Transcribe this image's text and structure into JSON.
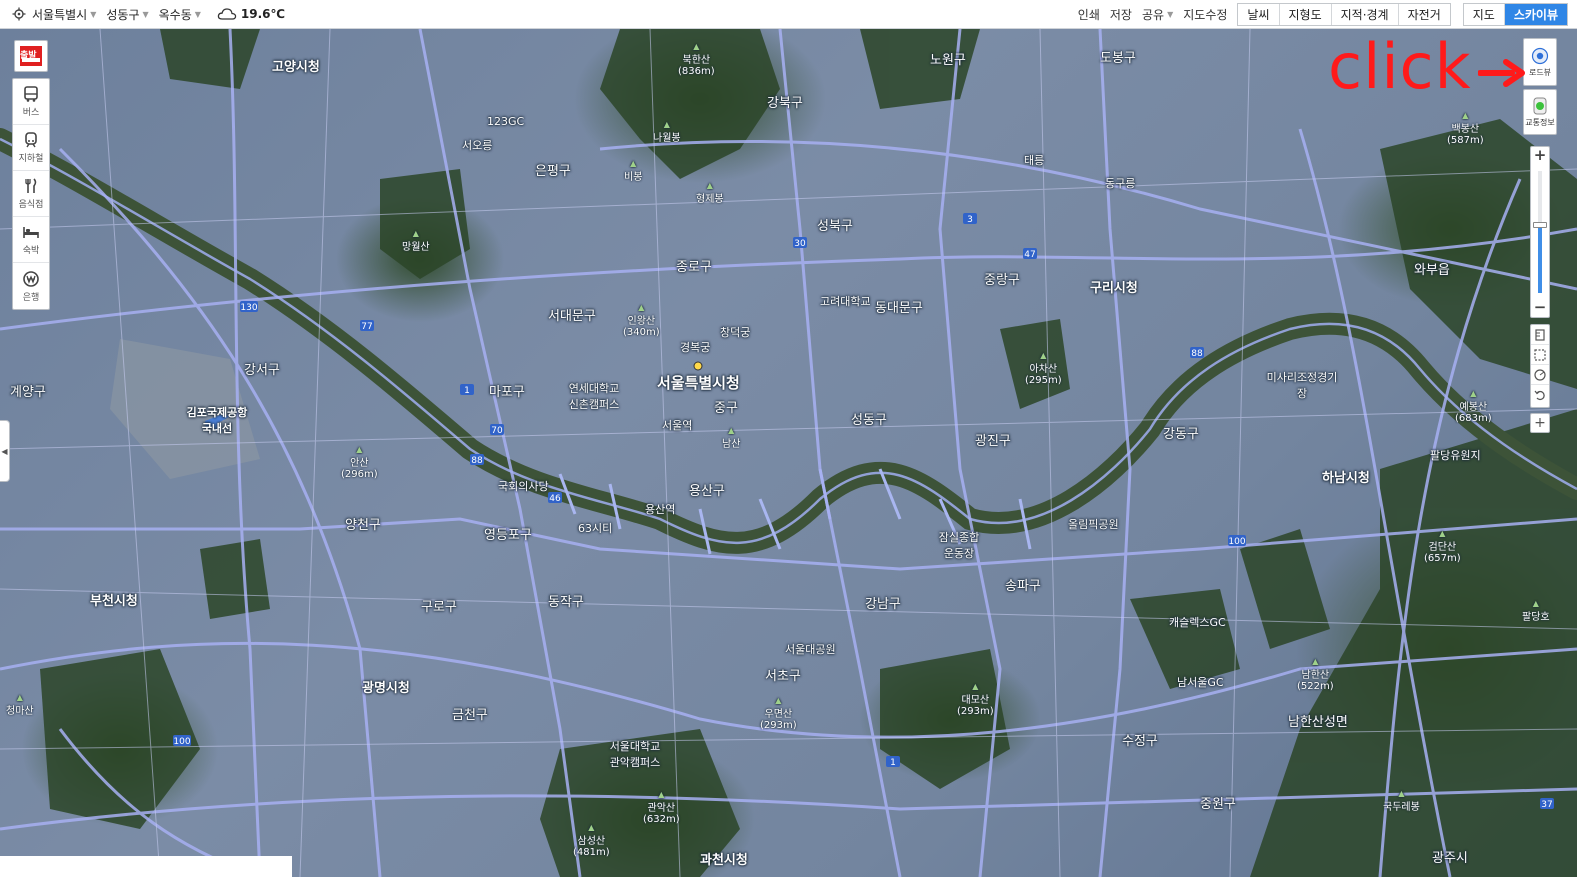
{
  "location": {
    "city": "서울특별시",
    "district": "성동구",
    "neighborhood": "옥수동",
    "temperature": "19.6℃"
  },
  "top_links": [
    "인쇄",
    "저장",
    "공유",
    "지도수정"
  ],
  "layer_buttons": [
    "날씨",
    "지형도",
    "지적·경계",
    "자전거"
  ],
  "view_buttons": [
    "지도",
    "스카이뷰"
  ],
  "active_view": "스카이뷰",
  "side_panel": {
    "depart_label": "출발",
    "items": [
      "버스",
      "지하철",
      "음식점",
      "숙박",
      "은행"
    ]
  },
  "right_controls": {
    "road_view_label": "로드뷰",
    "traffic_label": "교통정보",
    "zoom_level_fraction": 0.56
  },
  "annotation": {
    "text": "click",
    "color": "#ff1a1a"
  },
  "map_labels": {
    "main": [
      {
        "text": "서울특별시청",
        "class": "big"
      },
      {
        "text": "고양시청",
        "class": "city"
      },
      {
        "text": "부천시청",
        "class": "city"
      },
      {
        "text": "광명시청",
        "class": "city"
      },
      {
        "text": "구리시청",
        "class": "city"
      },
      {
        "text": "하남시청",
        "class": "city"
      },
      {
        "text": "과천시청",
        "class": "city"
      },
      {
        "text": "김포국제공항 국내선",
        "class": "city"
      },
      {
        "text": "강북구",
        "class": ""
      },
      {
        "text": "은평구",
        "class": ""
      },
      {
        "text": "종로구",
        "class": ""
      },
      {
        "text": "성북구",
        "class": ""
      },
      {
        "text": "동대문구",
        "class": ""
      },
      {
        "text": "중랑구",
        "class": ""
      },
      {
        "text": "노원구",
        "class": ""
      },
      {
        "text": "도봉구",
        "class": ""
      },
      {
        "text": "서대문구",
        "class": ""
      },
      {
        "text": "마포구",
        "class": ""
      },
      {
        "text": "중구",
        "class": ""
      },
      {
        "text": "용산구",
        "class": ""
      },
      {
        "text": "성동구",
        "class": ""
      },
      {
        "text": "광진구",
        "class": ""
      },
      {
        "text": "강동구",
        "class": ""
      },
      {
        "text": "강서구",
        "class": ""
      },
      {
        "text": "양천구",
        "class": ""
      },
      {
        "text": "영등포구",
        "class": ""
      },
      {
        "text": "구로구",
        "class": ""
      },
      {
        "text": "동작구",
        "class": ""
      },
      {
        "text": "금천구",
        "class": ""
      },
      {
        "text": "강남구",
        "class": ""
      },
      {
        "text": "송파구",
        "class": ""
      },
      {
        "text": "서초구",
        "class": ""
      },
      {
        "text": "수정구",
        "class": ""
      },
      {
        "text": "중원구",
        "class": ""
      },
      {
        "text": "계양구",
        "class": ""
      },
      {
        "text": "와부읍",
        "class": ""
      },
      {
        "text": "남한산성면",
        "class": ""
      },
      {
        "text": "광주시",
        "class": ""
      },
      {
        "text": "경복궁",
        "class": "small"
      },
      {
        "text": "창덕궁",
        "class": "small"
      },
      {
        "text": "서울역",
        "class": "small"
      },
      {
        "text": "국회의사당",
        "class": "small"
      },
      {
        "text": "63시티",
        "class": "small"
      },
      {
        "text": "용산역",
        "class": "small"
      },
      {
        "text": "잠실종합운동장",
        "class": "small"
      },
      {
        "text": "올림픽공원",
        "class": "small"
      },
      {
        "text": "서울대공원",
        "class": "small"
      },
      {
        "text": "123GC",
        "class": "small"
      },
      {
        "text": "서오릉",
        "class": "small"
      },
      {
        "text": "태릉",
        "class": "small"
      },
      {
        "text": "동구릉",
        "class": "small"
      },
      {
        "text": "남서울GC",
        "class": "small"
      },
      {
        "text": "캐슬렉스GC",
        "class": "small"
      },
      {
        "text": "고려대학교",
        "class": "small"
      },
      {
        "text": "연세대학교 신촌캠퍼스",
        "class": "small"
      },
      {
        "text": "서울대학교 관악캠퍼스",
        "class": "small"
      },
      {
        "text": "팔당유원지",
        "class": "small"
      },
      {
        "text": "미사리조정경기장",
        "class": "small"
      }
    ],
    "peaks": [
      {
        "name": "북한산",
        "elev": "(836m)"
      },
      {
        "name": "나월봉",
        "elev": ""
      },
      {
        "name": "비봉",
        "elev": ""
      },
      {
        "name": "형제봉",
        "elev": ""
      },
      {
        "name": "안산",
        "elev": "(296m)"
      },
      {
        "name": "인왕산",
        "elev": "(340m)"
      },
      {
        "name": "남산",
        "elev": ""
      },
      {
        "name": "아차산",
        "elev": "(295m)"
      },
      {
        "name": "백봉산",
        "elev": "(587m)"
      },
      {
        "name": "예봉산",
        "elev": "(683m)"
      },
      {
        "name": "검단산",
        "elev": "(657m)"
      },
      {
        "name": "남한산",
        "elev": "(522m)"
      },
      {
        "name": "대모산",
        "elev": "(293m)"
      },
      {
        "name": "관악산",
        "elev": "(632m)"
      },
      {
        "name": "삼성산",
        "elev": "(481m)"
      },
      {
        "name": "우면산",
        "elev": "(293m)"
      },
      {
        "name": "망월산",
        "elev": ""
      },
      {
        "name": "청마산",
        "elev": ""
      },
      {
        "name": "국두레봉",
        "elev": ""
      },
      {
        "name": "팔당호",
        "elev": ""
      }
    ]
  }
}
